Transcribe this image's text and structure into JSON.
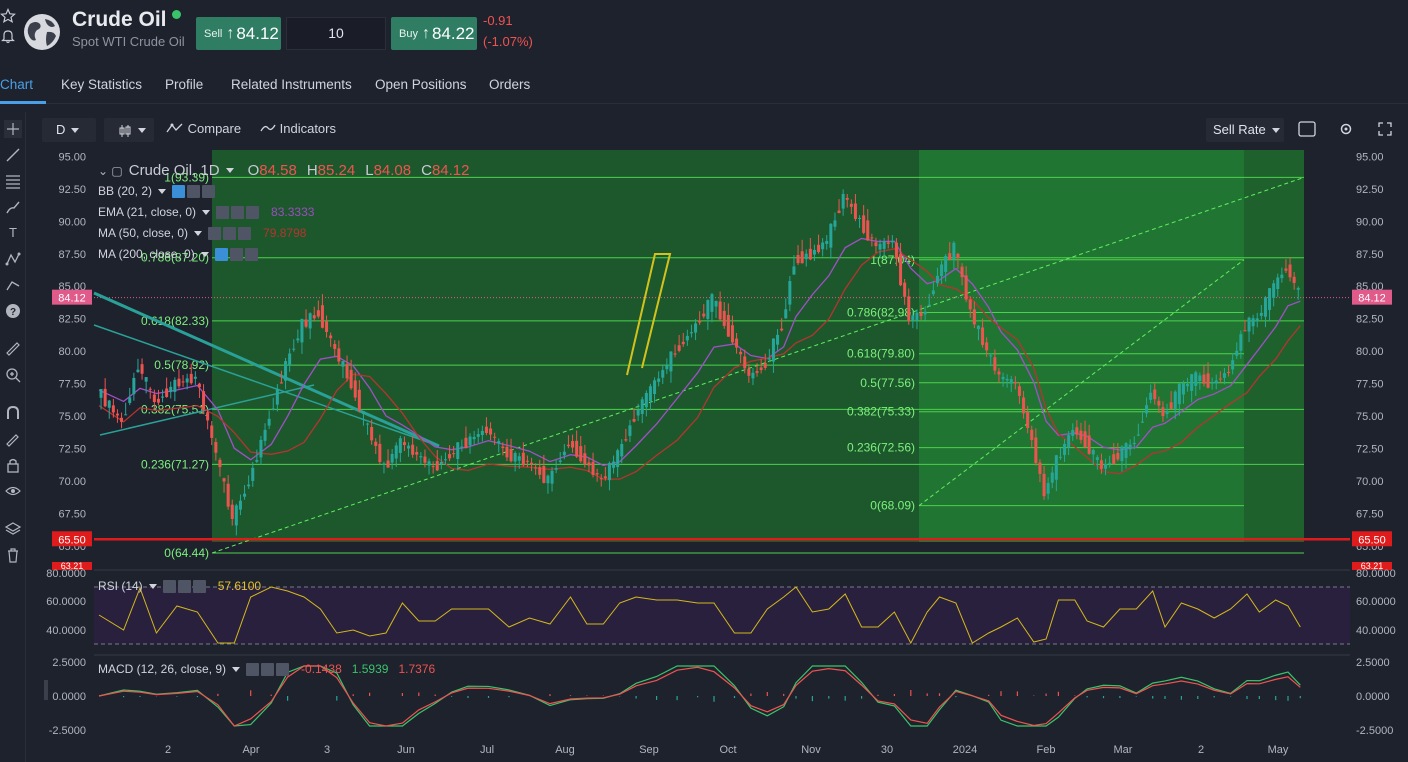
{
  "header": {
    "title": "Crude Oil",
    "subtitle": "Spot WTI Crude Oil",
    "sell_label": "Sell",
    "sell_price": "84.12",
    "quantity": "10",
    "buy_label": "Buy",
    "buy_price": "84.22",
    "change_abs": "-0.91",
    "change_pct": "(-1.07%)",
    "status_color": "#3ac46a",
    "trade_color": "#2f7d63"
  },
  "tabs": [
    {
      "label": "Chart",
      "active": true
    },
    {
      "label": "Key Statistics"
    },
    {
      "label": "Profile"
    },
    {
      "label": "Related Instruments"
    },
    {
      "label": "Open Positions"
    },
    {
      "label": "Orders"
    }
  ],
  "toolbar": {
    "interval": "D",
    "compare": "Compare",
    "indicators": "Indicators",
    "rate": "Sell Rate"
  },
  "left_tools": [
    "crosshair-icon",
    "trend-line-icon",
    "fib-icon",
    "brush-icon",
    "text-icon",
    "pattern-icon",
    "prediction-icon",
    "ruler-icon",
    "zoom-icon",
    "magnet-icon",
    "lock-drawing-icon",
    "lock-icon",
    "eye-icon",
    "layers-icon",
    "trash-icon"
  ],
  "legend": {
    "symbol": "Crude Oil, 1D",
    "open_label": "O",
    "open": "84.58",
    "high_label": "H",
    "high": "85.24",
    "low_label": "L",
    "low": "84.08",
    "close_label": "C",
    "close": "84.12",
    "bb": "BB (20, 2)",
    "ema": "EMA (21, close, 0)",
    "ema_value": "83.3333",
    "ma50": "MA (50, close, 0)",
    "ma50_value": "79.8798",
    "ma200": "MA (200, close, 0)",
    "rsi": "RSI (14)",
    "rsi_value": "57.6100",
    "macd": "MACD (12, 26, close, 9)",
    "macd_hist": "-0.1438",
    "macd_line": "1.5939",
    "macd_signal": "1.7376"
  },
  "chart_data": {
    "type": "candlestick",
    "symbol": "Crude Oil",
    "interval": "1D",
    "last_price": 84.12,
    "last_price_label": "84.12",
    "support_level": 65.5,
    "support_label": "65.50",
    "low_marker_label": "63.21",
    "ylim": [
      63.21,
      95.5
    ],
    "y_ticks": [
      "95.00",
      "92.50",
      "90.00",
      "87.50",
      "85.00",
      "82.50",
      "80.00",
      "77.50",
      "75.00",
      "72.50",
      "70.00",
      "67.50",
      "65.00"
    ],
    "x_ticks": [
      "2",
      "Apr",
      "3",
      "Jun",
      "Jul",
      "Aug",
      "Sep",
      "Oct",
      "Nov",
      "30",
      "2024",
      "Feb",
      "Mar",
      "2",
      "May"
    ],
    "fib_1": {
      "levels": [
        {
          "ratio": "1",
          "price": 93.39,
          "label": "1(93.39)"
        },
        {
          "ratio": "0.786",
          "price": 87.2,
          "label": "0.786(87.20)"
        },
        {
          "ratio": "0.618",
          "price": 82.33,
          "label": "0.618(82.33)"
        },
        {
          "ratio": "0.5",
          "price": 78.92,
          "label": "0.5(78.92)"
        },
        {
          "ratio": "0.382",
          "price": 75.51,
          "label": "0.382(75.51)"
        },
        {
          "ratio": "0.236",
          "price": 71.27,
          "label": "0.236(71.27)"
        },
        {
          "ratio": "0",
          "price": 64.44,
          "label": "0(64.44)"
        }
      ]
    },
    "fib_2": {
      "levels": [
        {
          "ratio": "1",
          "price": 87.04,
          "label": "1(87.04)"
        },
        {
          "ratio": "0.786",
          "price": 82.98,
          "label": "0.786(82.98)"
        },
        {
          "ratio": "0.618",
          "price": 79.8,
          "label": "0.618(79.80)"
        },
        {
          "ratio": "0.5",
          "price": 77.56,
          "label": "0.5(77.56)"
        },
        {
          "ratio": "0.382",
          "price": 75.33,
          "label": "0.382(75.33)"
        },
        {
          "ratio": "0.236",
          "price": 72.56,
          "label": "0.236(72.56)"
        },
        {
          "ratio": "0",
          "price": 68.09,
          "label": "0(68.09)"
        }
      ]
    },
    "rsi_ticks": [
      "80.0000",
      "60.0000",
      "40.0000"
    ],
    "macd_ticks": [
      "2.5000",
      "0.0000",
      "-2.5000"
    ],
    "path_points": [
      [
        0,
        77
      ],
      [
        12,
        74.5
      ],
      [
        20,
        79
      ],
      [
        28,
        76
      ],
      [
        38,
        77.5
      ],
      [
        48,
        78
      ],
      [
        58,
        72
      ],
      [
        66,
        67
      ],
      [
        74,
        70
      ],
      [
        84,
        75
      ],
      [
        92,
        79
      ],
      [
        100,
        82
      ],
      [
        108,
        83
      ],
      [
        116,
        80
      ],
      [
        124,
        77.5
      ],
      [
        132,
        74
      ],
      [
        140,
        71
      ],
      [
        148,
        73
      ],
      [
        156,
        72
      ],
      [
        164,
        71
      ],
      [
        172,
        72
      ],
      [
        180,
        73
      ],
      [
        190,
        74
      ],
      [
        200,
        72
      ],
      [
        210,
        71.5
      ],
      [
        220,
        70
      ],
      [
        230,
        73
      ],
      [
        238,
        71.5
      ],
      [
        246,
        70
      ],
      [
        254,
        72
      ],
      [
        262,
        75
      ],
      [
        272,
        77.5
      ],
      [
        282,
        80
      ],
      [
        292,
        82
      ],
      [
        300,
        84
      ],
      [
        310,
        81
      ],
      [
        318,
        78
      ],
      [
        326,
        79
      ],
      [
        334,
        82
      ],
      [
        340,
        87
      ],
      [
        348,
        87.5
      ],
      [
        356,
        88.5
      ],
      [
        364,
        92
      ],
      [
        372,
        90
      ],
      [
        380,
        88
      ],
      [
        388,
        88.5
      ],
      [
        396,
        82.5
      ],
      [
        404,
        83
      ],
      [
        410,
        86
      ],
      [
        418,
        88
      ],
      [
        426,
        83
      ],
      [
        434,
        80
      ],
      [
        440,
        78
      ],
      [
        448,
        77.5
      ],
      [
        456,
        73
      ],
      [
        462,
        69
      ],
      [
        468,
        71.5
      ],
      [
        476,
        74
      ],
      [
        482,
        73
      ],
      [
        490,
        71
      ],
      [
        498,
        72
      ],
      [
        506,
        73
      ],
      [
        514,
        77
      ],
      [
        520,
        75
      ],
      [
        528,
        77
      ],
      [
        536,
        78
      ],
      [
        544,
        77.5
      ],
      [
        552,
        78.5
      ],
      [
        560,
        82
      ],
      [
        566,
        82.5
      ],
      [
        574,
        85
      ],
      [
        580,
        86.5
      ],
      [
        586,
        84.5
      ]
    ]
  }
}
